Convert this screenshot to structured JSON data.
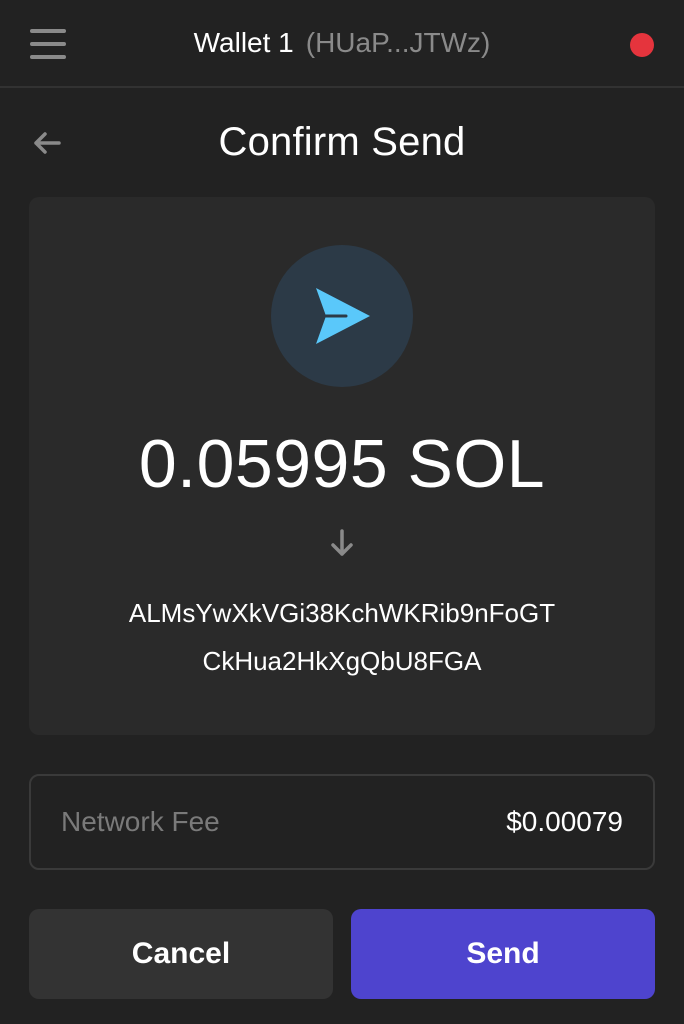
{
  "header": {
    "wallet_name": "Wallet 1",
    "wallet_address": "(HUaP...JTWz)",
    "status_color": "#e5343d"
  },
  "page": {
    "title": "Confirm Send"
  },
  "transaction": {
    "amount": "0.05995 SOL",
    "recipient_line1": "ALMsYwXkVGi38KchWKRib9nFoGT",
    "recipient_line2": "CkHua2HkXgQbU8FGA"
  },
  "fee": {
    "label": "Network Fee",
    "value": "$0.00079"
  },
  "actions": {
    "cancel_label": "Cancel",
    "send_label": "Send"
  },
  "colors": {
    "background": "#222222",
    "card": "#2a2a2a",
    "accent": "#4e44ce",
    "send_icon": "#5ac8fa"
  },
  "icons": [
    "menu-icon",
    "back-arrow-icon",
    "send-icon",
    "down-arrow-icon"
  ]
}
